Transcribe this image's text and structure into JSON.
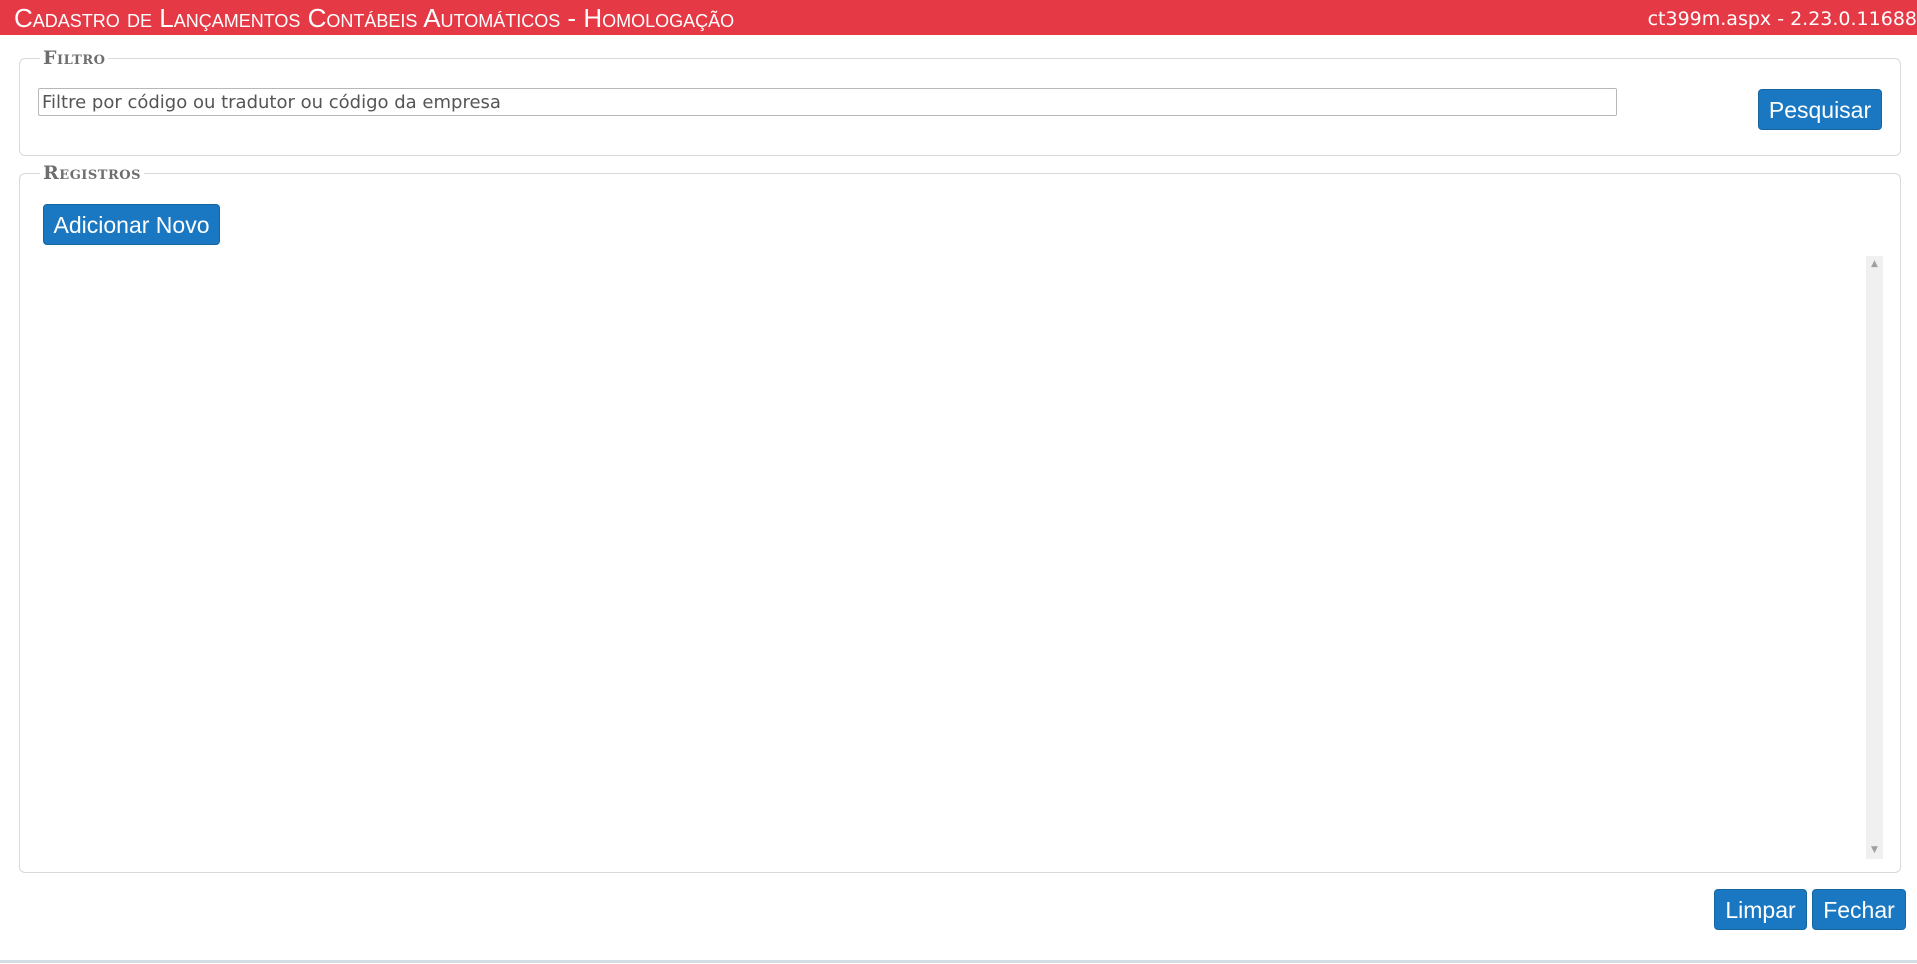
{
  "header": {
    "title": "Cadastro de Lançamentos Contábeis Automáticos  - Homologação",
    "version": "ct399m.aspx - 2.23.0.11688",
    "background_color": "#e63946"
  },
  "filter": {
    "legend": "Filtro",
    "search_placeholder": "Filtre por código ou tradutor ou código da empresa",
    "search_value": "",
    "search_button_label": "Pesquisar"
  },
  "records": {
    "legend": "Registros",
    "add_button_label": "Adicionar Novo",
    "items": []
  },
  "footer": {
    "clear_button_label": "Limpar",
    "close_button_label": "Fechar"
  },
  "colors": {
    "button": "#1a78c2",
    "legend_text": "#6e6e6e"
  },
  "icons": {
    "scroll_up": "scroll-up-arrow-icon",
    "scroll_down": "scroll-down-arrow-icon"
  }
}
